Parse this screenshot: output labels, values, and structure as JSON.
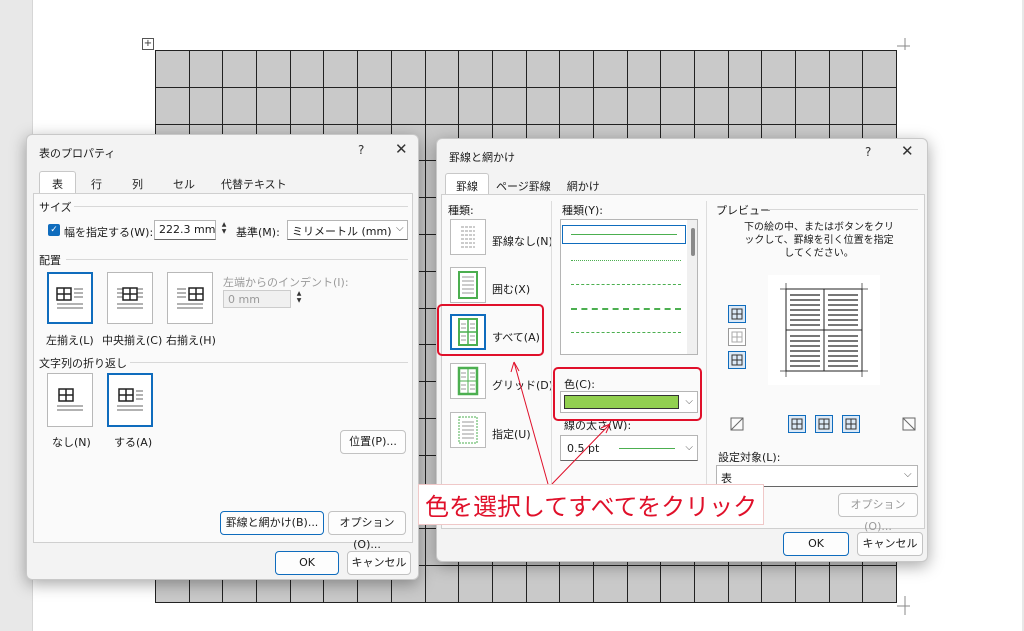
{
  "table_props": {
    "title": "表のプロパティ",
    "help": "?",
    "tabs": [
      "表",
      "行",
      "列",
      "セル",
      "代替テキスト"
    ],
    "size_group": "サイズ",
    "width_label": "幅を指定する(W):",
    "width_value": "222.3 mm",
    "unit_label": "基準(M):",
    "unit_value": "ミリメートル (mm)",
    "align_group": "配置",
    "indent_label": "左端からのインデント(I):",
    "indent_value": "0 mm",
    "align_left": "左揃え(L)",
    "align_center": "中央揃え(C)",
    "align_right": "右揃え(H)",
    "wrap_group": "文字列の折り返し",
    "wrap_none": "なし(N)",
    "wrap_around": "する(A)",
    "position_button": "位置(P)...",
    "borders_button": "罫線と網かけ(B)...",
    "options_button": "オプション(O)...",
    "ok": "OK",
    "cancel": "キャンセル"
  },
  "borders": {
    "title": "罫線と網かけ",
    "help": "?",
    "tabs": [
      "罫線",
      "ページ罫線",
      "網かけ"
    ],
    "kind_label": "種類:",
    "setting_none": "罫線なし(N)",
    "setting_box": "囲む(X)",
    "setting_all": "すべて(A)",
    "setting_grid": "グリッド(D)",
    "setting_custom": "指定(U)",
    "style_label": "種類(Y):",
    "color_label": "色(C):",
    "color_value": "#92d050",
    "width_label": "線の太さ(W):",
    "width_value": "0.5 pt",
    "preview_label": "プレビュー",
    "preview_hint": "下の絵の中、またはボタンをクリックして、罫線を引く位置を指定してください。",
    "apply_label": "設定対象(L):",
    "apply_value": "表",
    "options_button": "オプション(O)...",
    "ok": "OK",
    "cancel": "キャンセル"
  },
  "annotation": "色を選択してすべてをクリック",
  "colors": {
    "accent": "#0f6cbd",
    "highlight": "#e0102a",
    "border_color": "#92d050"
  }
}
